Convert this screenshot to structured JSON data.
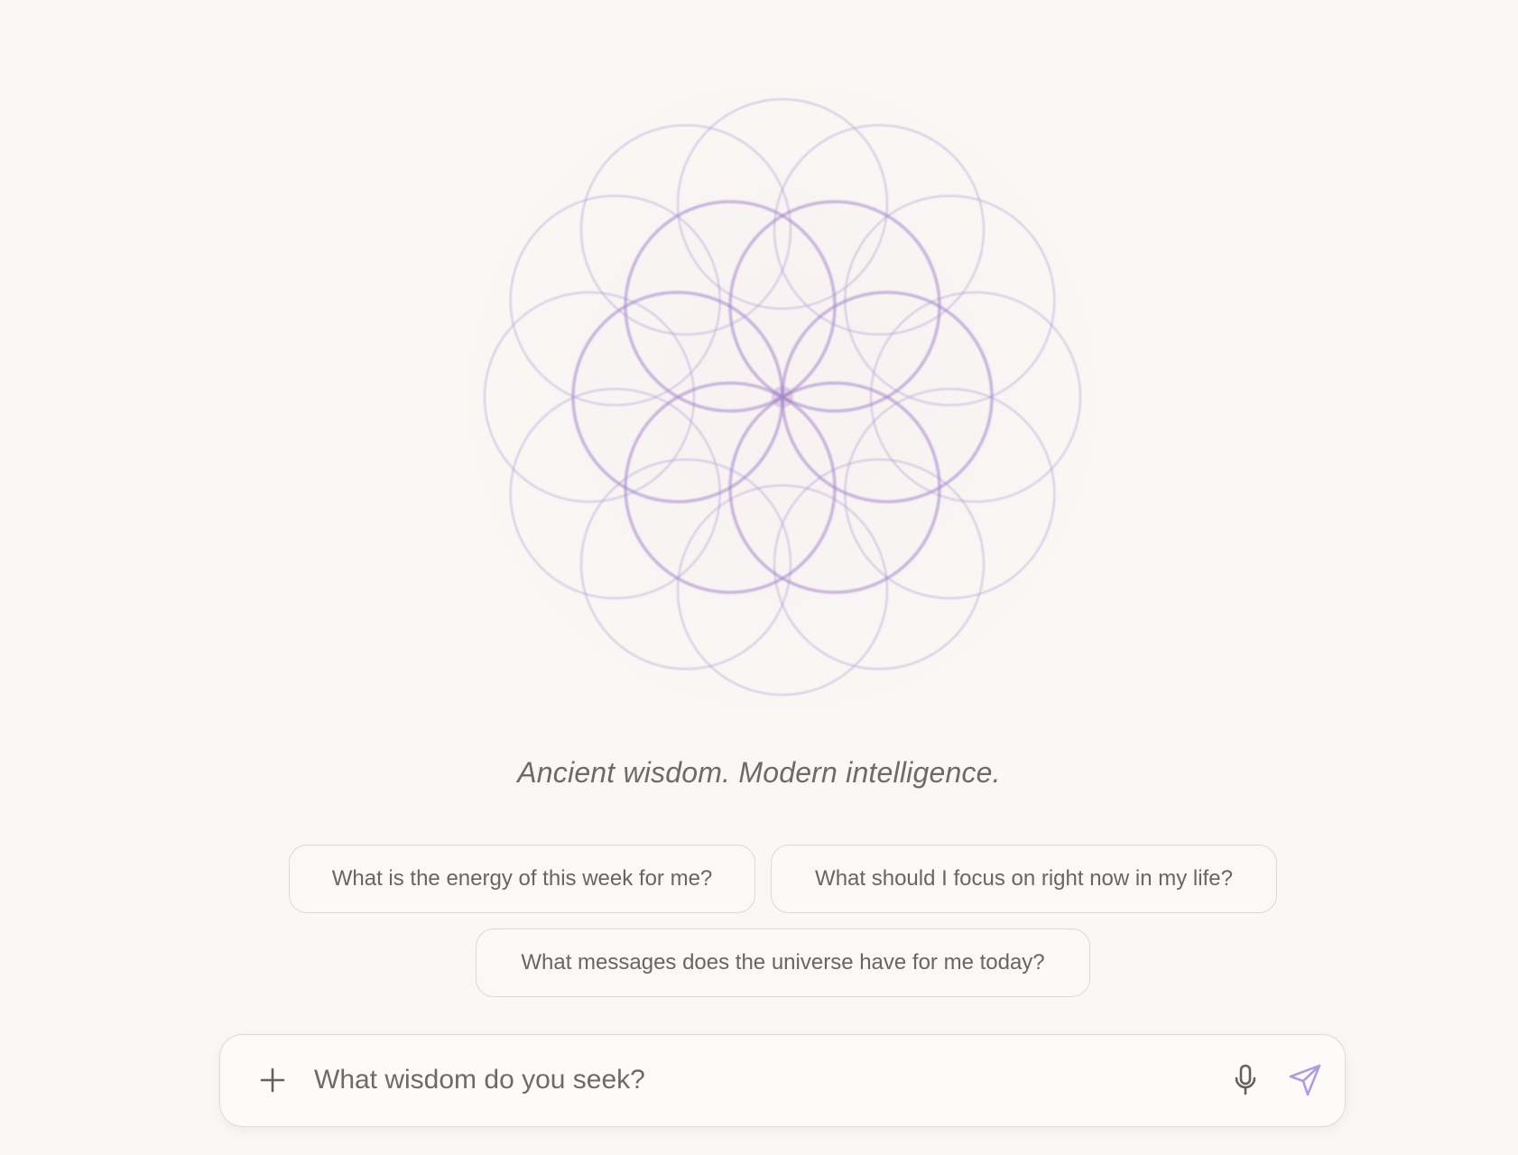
{
  "tagline": "Ancient wisdom. Modern intelligence.",
  "suggestions": [
    "What is the energy of this week for me?",
    "What should I focus on right now in my life?",
    "What messages does the universe have for me today?"
  ],
  "composer": {
    "placeholder": "What wisdom do you seek?",
    "attach_icon": "plus-icon",
    "mic_icon": "microphone-icon",
    "send_icon": "send-icon"
  },
  "colors": {
    "background": "#f9f8f5",
    "accent": "#9b7fc4",
    "text": "#6e6a66",
    "chip_border": "#dcd9d3"
  },
  "logo": {
    "icon": "flower-of-life-icon"
  }
}
